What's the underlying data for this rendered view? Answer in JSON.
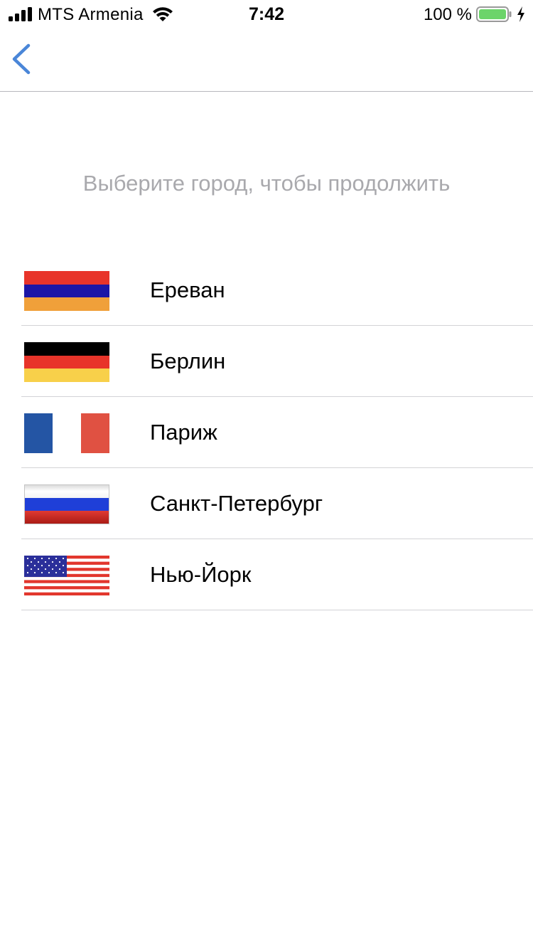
{
  "status_bar": {
    "carrier": "MTS Armenia",
    "time": "7:42",
    "battery_percent": "100 %",
    "icons": [
      "signal-icon",
      "wifi-icon",
      "battery-icon",
      "charging-bolt-icon"
    ]
  },
  "nav": {
    "back_icon": "chevron-left-icon",
    "accent_color": "#4a86d8"
  },
  "prompt": "Выберите город, чтобы продолжить",
  "cities": [
    {
      "name": "Ереван",
      "flag": "armenia-flag-icon"
    },
    {
      "name": "Берлин",
      "flag": "germany-flag-icon"
    },
    {
      "name": "Париж",
      "flag": "france-flag-icon"
    },
    {
      "name": "Санкт-Петербург",
      "flag": "russia-flag-icon"
    },
    {
      "name": "Нью-Йорк",
      "flag": "usa-flag-icon"
    }
  ],
  "colors": {
    "battery_fill": "#6cd46a",
    "divider": "#d3d3d6",
    "prompt_text": "#a9a9ad"
  }
}
